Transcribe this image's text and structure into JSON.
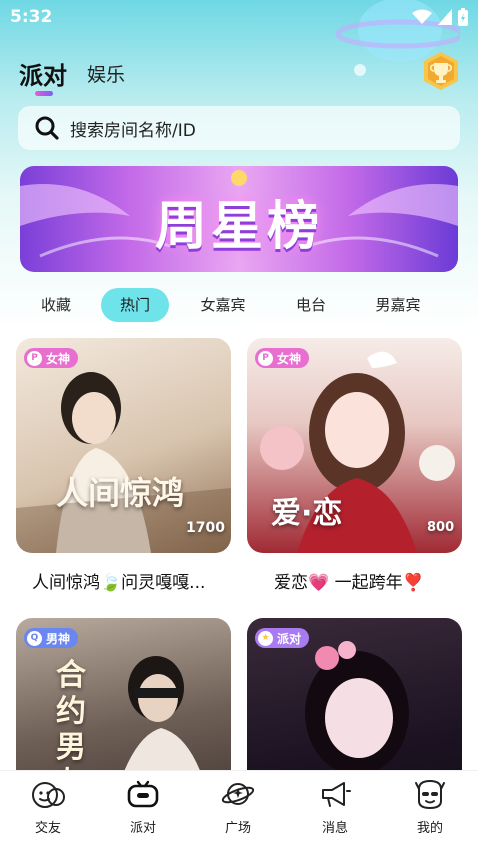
{
  "status_bar": {
    "time": "5:32"
  },
  "header": {
    "tabs": [
      {
        "label": "派对"
      },
      {
        "label": "娱乐"
      }
    ],
    "trophy_icon": "trophy-icon"
  },
  "search": {
    "placeholder": "搜索房间名称/ID"
  },
  "banner": {
    "title": "周星榜"
  },
  "filters": [
    {
      "label": "收藏"
    },
    {
      "label": "热门"
    },
    {
      "label": "女嘉宾"
    },
    {
      "label": "电台"
    },
    {
      "label": "男嘉宾"
    }
  ],
  "rooms": [
    {
      "badge": "女神",
      "title": "人间惊鸿🍃问灵嘎嘎...",
      "overlay": "人间惊鸿",
      "overlay_sub": "1700"
    },
    {
      "badge": "女神",
      "title": "爱恋💗 一起跨年❣️",
      "overlay": "爱·恋",
      "overlay_sub": "800"
    },
    {
      "badge": "男神",
      "title": "",
      "overlay": "合约男友",
      "overlay_sub": ""
    },
    {
      "badge": "派对",
      "title": "",
      "overlay": "",
      "overlay_sub": ""
    }
  ],
  "bottom_nav": [
    {
      "label": "交友",
      "icon": "make-friends-icon"
    },
    {
      "label": "派对",
      "icon": "party-gamepad-icon"
    },
    {
      "label": "广场",
      "icon": "plaza-planet-icon"
    },
    {
      "label": "消息",
      "icon": "message-megaphone-icon"
    },
    {
      "label": "我的",
      "icon": "profile-avatar-icon"
    }
  ],
  "colors": {
    "accent": "#6fe3ea",
    "badge_female": "#e86fcf",
    "badge_male": "#6a86f0",
    "badge_party": "#a97bf0"
  }
}
